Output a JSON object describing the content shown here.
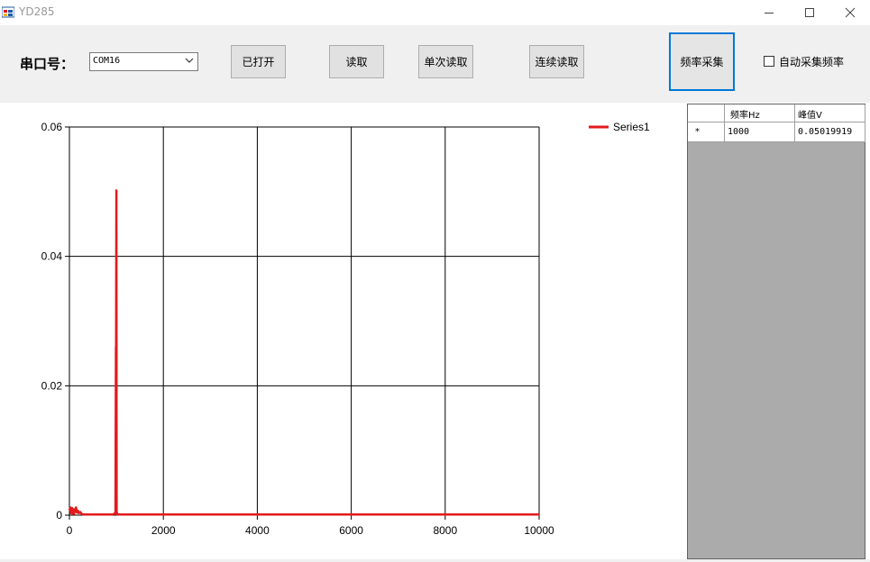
{
  "window": {
    "title": "YD285"
  },
  "toolbar": {
    "port_label": "串口号：",
    "port_value": "COM16",
    "open_label": "已打开",
    "read_label": "读取",
    "single_read_label": "单次读取",
    "continuous_read_label": "连续读取",
    "freq_capture_label": "频率采集",
    "auto_capture_label": "自动采集频率",
    "auto_capture_checked": false
  },
  "table": {
    "headers": [
      "频率Hz",
      "峰值V"
    ],
    "rows": [
      {
        "marker": "*",
        "freq": "1000",
        "peak": "0.05019919"
      }
    ]
  },
  "chart_data": {
    "type": "line",
    "x_ticks": [
      "0",
      "2000",
      "4000",
      "6000",
      "8000",
      "10000"
    ],
    "y_ticks": [
      "0",
      "0.02",
      "0.04",
      "0.06"
    ],
    "xlim": [
      0,
      10000
    ],
    "ylim": [
      0,
      0.06
    ],
    "grid": true,
    "legend_position": "top-right",
    "series": [
      {
        "name": "Series1",
        "color": "#e31a1c",
        "x": [
          0,
          10,
          20,
          30,
          40,
          50,
          60,
          70,
          80,
          90,
          100,
          120,
          140,
          160,
          180,
          200,
          230,
          260,
          300,
          400,
          500,
          600,
          700,
          800,
          900,
          960,
          980,
          990,
          995,
          1000,
          1005,
          1010,
          1020,
          1040,
          1100,
          1500,
          2000,
          3000,
          4000,
          5000,
          6000,
          7000,
          8000,
          9000,
          10000
        ],
        "y": [
          0.001,
          0.0008,
          0.0012,
          0.0003,
          0.001,
          0.0006,
          0.0011,
          0.0002,
          0.0009,
          0.0005,
          0.0002,
          0.0009,
          0.0012,
          0.0004,
          0.0007,
          0.0003,
          0.0005,
          0.0002,
          0.0001,
          0.0001,
          0.0001,
          0.0001,
          0.0001,
          0.0001,
          0.0001,
          0.0002,
          0.0005,
          0.026,
          0.026,
          0.0502,
          0.0001,
          0.0004,
          0.0002,
          0.0001,
          0.0001,
          0.0001,
          0.0001,
          0.0001,
          0.0001,
          0.0001,
          0.0001,
          0.0001,
          0.0001,
          0.0001,
          0.0001
        ]
      }
    ]
  }
}
